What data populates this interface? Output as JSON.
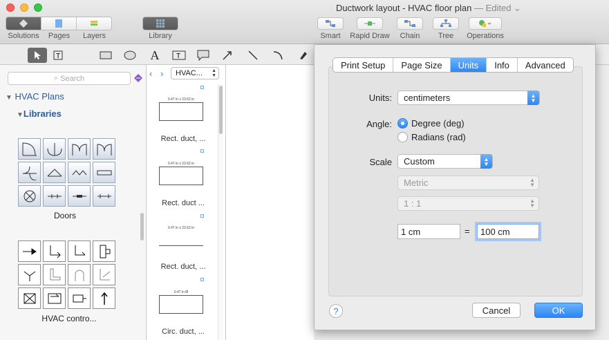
{
  "window": {
    "title": "Ductwork layout - HVAC floor plan",
    "edited": "— Edited ⌄"
  },
  "toolbar": {
    "nav": [
      "Solutions",
      "Pages",
      "Layers"
    ],
    "library": "Library",
    "right": [
      "Smart",
      "Rapid Draw",
      "Chain",
      "Tree",
      "Operations"
    ]
  },
  "sidebar": {
    "search_placeholder": "Search",
    "tree": [
      "HVAC Plans",
      "Libraries"
    ],
    "groups": [
      "Doors",
      "HVAC contro..."
    ]
  },
  "library_panel": {
    "selector": "HVAC...",
    "shapes": [
      {
        "dim": "0.47 in x 23.62 in",
        "label": "Rect. duct, ..."
      },
      {
        "dim": "0.47 in x 23.62 in",
        "label": "Rect. duct ..."
      },
      {
        "dim": "0.47 in x 23.62 in",
        "label": "Rect. duct, ..."
      },
      {
        "dim": "0.47 in Ø",
        "label": "Circ. duct, ..."
      }
    ]
  },
  "dialog": {
    "tabs": [
      "Print Setup",
      "Page Size",
      "Units",
      "Info",
      "Advanced"
    ],
    "active_tab": "Units",
    "units_label": "Units:",
    "units_value": "centimeters",
    "angle_label": "Angle:",
    "angle_options": [
      "Degree (deg)",
      "Radians (rad)"
    ],
    "angle_selected": "Degree (deg)",
    "scale_label": "Scale",
    "scale_value": "Custom",
    "metric_value": "Metric",
    "ratio_value": "1 : 1",
    "scale_left": "1 cm",
    "equals": "=",
    "scale_right": "100 cm",
    "cancel": "Cancel",
    "ok": "OK",
    "help": "?"
  },
  "colors": {
    "accent": "#2d86f4"
  }
}
